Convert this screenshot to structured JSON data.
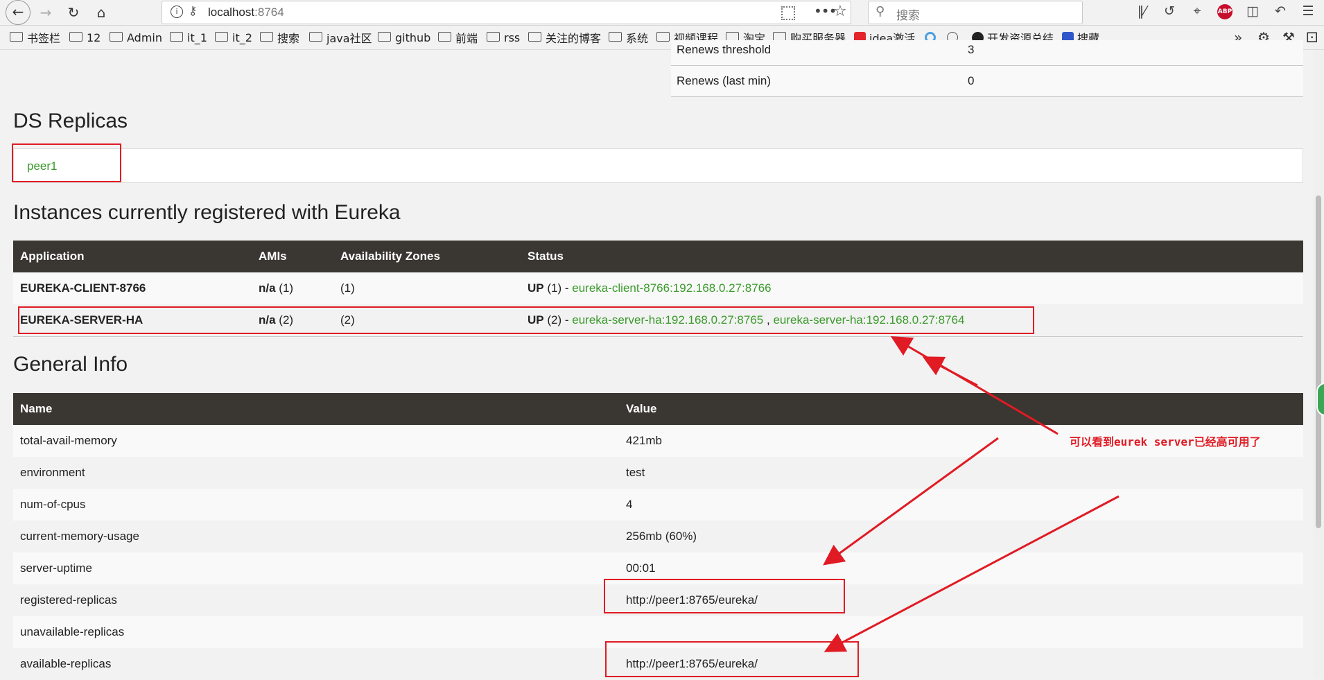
{
  "browser": {
    "url_host": "localhost",
    "url_port": ":8764",
    "search_placeholder": "搜索",
    "abp_label": "ABP",
    "bookmarks": [
      {
        "label": "书签栏",
        "type": "folder"
      },
      {
        "label": "12",
        "type": "folder"
      },
      {
        "label": "Admin",
        "type": "folder"
      },
      {
        "label": "it_1",
        "type": "folder"
      },
      {
        "label": "it_2",
        "type": "folder"
      },
      {
        "label": "搜索",
        "type": "folder"
      },
      {
        "label": "java社区",
        "type": "folder"
      },
      {
        "label": "github",
        "type": "folder"
      },
      {
        "label": "前端",
        "type": "folder"
      },
      {
        "label": "rss",
        "type": "folder"
      },
      {
        "label": "关注的博客",
        "type": "folder"
      },
      {
        "label": "系统",
        "type": "folder"
      },
      {
        "label": "视频课程",
        "type": "folder"
      },
      {
        "label": "淘宝",
        "type": "folder"
      },
      {
        "label": "购买服务器",
        "type": "folder"
      },
      {
        "label": "idea激活",
        "type": "link"
      },
      {
        "label": "开发资源总结",
        "type": "link"
      },
      {
        "label": "搜藏",
        "type": "link"
      }
    ]
  },
  "lease": {
    "rows": [
      {
        "name": "Renews threshold",
        "value": "3"
      },
      {
        "name": "Renews (last min)",
        "value": "0"
      }
    ]
  },
  "ds_replicas": {
    "title": "DS Replicas",
    "items": [
      "peer1"
    ]
  },
  "instances": {
    "title": "Instances currently registered with Eureka",
    "headers": [
      "Application",
      "AMIs",
      "Availability Zones",
      "Status"
    ],
    "rows": [
      {
        "application": "EUREKA-CLIENT-8766",
        "ami_bold": "n/a",
        "ami_count": "(1)",
        "zones": "(1)",
        "status_bold": "UP",
        "status_count": "(1) -",
        "links": [
          "eureka-client-8766:192.168.0.27:8766"
        ]
      },
      {
        "application": "EUREKA-SERVER-HA",
        "ami_bold": "n/a",
        "ami_count": "(2)",
        "zones": "(2)",
        "status_bold": "UP",
        "status_count": "(2) -",
        "links": [
          "eureka-server-ha:192.168.0.27:8765",
          "eureka-server-ha:192.168.0.27:8764"
        ],
        "link_separator": ","
      }
    ]
  },
  "general_info": {
    "title": "General Info",
    "headers": [
      "Name",
      "Value"
    ],
    "rows": [
      {
        "name": "total-avail-memory",
        "value": "421mb"
      },
      {
        "name": "environment",
        "value": "test"
      },
      {
        "name": "num-of-cpus",
        "value": "4"
      },
      {
        "name": "current-memory-usage",
        "value": "256mb (60%)"
      },
      {
        "name": "server-uptime",
        "value": "00:01"
      },
      {
        "name": "registered-replicas",
        "value": "http://peer1:8765/eureka/"
      },
      {
        "name": "unavailable-replicas",
        "value": ""
      },
      {
        "name": "available-replicas",
        "value": "http://peer1:8765/eureka/"
      }
    ]
  },
  "annotation": {
    "text": "可以看到eurek server已经高可用了",
    "color": "#e01b24"
  },
  "colors": {
    "link_green": "#3a9a2b",
    "table_header": "#3a3632",
    "highlight_red": "#e01b24"
  }
}
